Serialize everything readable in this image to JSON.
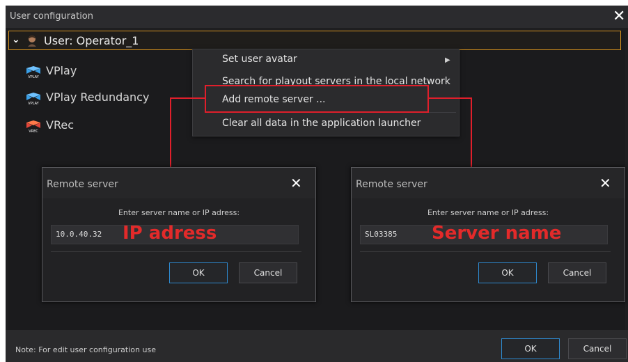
{
  "window": {
    "title": "User configuration",
    "close_icon": "close-icon"
  },
  "user": {
    "label": "User: Operator_1",
    "expanded": true
  },
  "apps": [
    {
      "label": "VPlay",
      "icon_text": "VPLAY",
      "icon": "vplay-icon"
    },
    {
      "label": "VPlay Redundancy",
      "icon_text": "VPLAY",
      "icon": "vplay-redundancy-icon"
    },
    {
      "label": "VRec",
      "icon_text": "VREC",
      "icon": "vrec-icon"
    }
  ],
  "context_menu": {
    "items": [
      {
        "label": "Set user avatar",
        "has_submenu": true
      },
      {
        "label": "Search for playout servers in the local network"
      },
      {
        "label": "Add remote server ..."
      },
      {
        "label": "Clear all data in the application launcher"
      }
    ]
  },
  "dialogs": [
    {
      "title": "Remote server",
      "prompt": "Enter server name or IP adress:",
      "value": "10.0.40.32",
      "annotation": "IP adress",
      "ok": "OK",
      "cancel": "Cancel"
    },
    {
      "title": "Remote server",
      "prompt": "Enter server name or IP adress:",
      "value": "SL03385",
      "annotation": "Server name",
      "ok": "OK",
      "cancel": "Cancel"
    }
  ],
  "footer": {
    "note": "Note: For edit user configuration use",
    "ok": "OK",
    "cancel": "Cancel"
  },
  "colors": {
    "highlight": "#e01f2b",
    "accent_border": "#d6921e",
    "primary_border": "#2e8ad0"
  }
}
